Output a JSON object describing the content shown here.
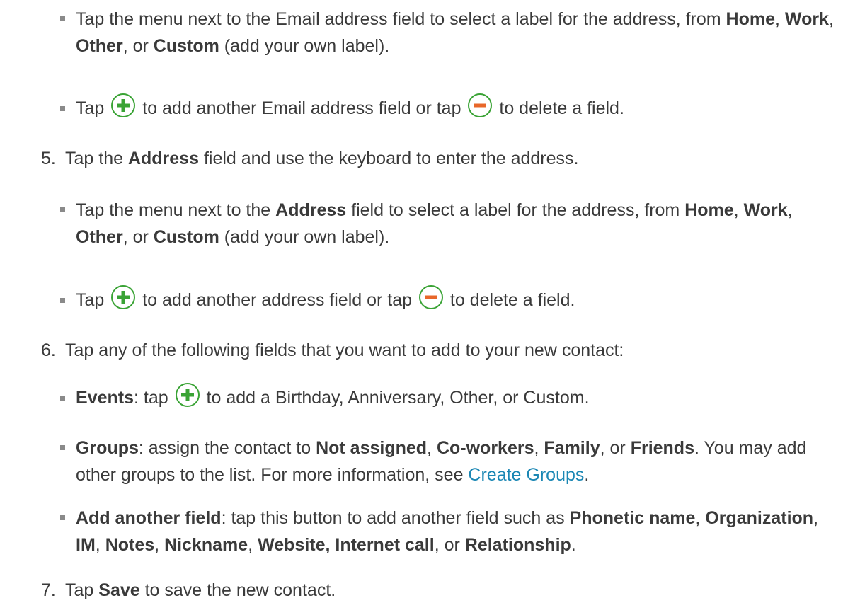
{
  "bullets_email": [
    {
      "t1": "Tap the menu next to the Email address field to select a label for the address, from ",
      "b1": "Home",
      "s1": ", ",
      "b2": "Work",
      "s2": ", ",
      "b3": "Other",
      "s3": ", or ",
      "b4": "Custom",
      "t2": " (add your own label)."
    },
    {
      "t1": "Tap ",
      "t2": " to add another Email address field or tap ",
      "t3": " to delete a field."
    }
  ],
  "step5": {
    "num": "5.",
    "t1": "Tap the ",
    "b1": "Address",
    "t2": " field and use the keyboard to enter the address.",
    "sub1": {
      "t1": "Tap the menu next to the ",
      "b1": "Address",
      "t2": " field to select a label for the address, from ",
      "b2": "Home",
      "s1": ", ",
      "b3": "Work",
      "s2": ", ",
      "b4": "Other",
      "s3": ", or ",
      "b5": "Custom",
      "t3": " (add your own label)."
    },
    "sub2": {
      "t1": "Tap ",
      "t2": " to add another address field or tap ",
      "t3": " to delete a field."
    }
  },
  "step6": {
    "num": "6.",
    "text": "Tap any of the following fields that you want to add to your new contact:",
    "events": {
      "b1": "Events",
      "t1": ": tap ",
      "t2": " to add a Birthday, Anniversary, Other, or Custom."
    },
    "groups": {
      "b1": "Groups",
      "t1": ": assign the contact to ",
      "b2": "Not assigned",
      "s1": ", ",
      "b3": "Co-workers",
      "s2": ", ",
      "b4": "Family",
      "s3": ", or ",
      "b5": "Friends",
      "t2": ". You may add other groups to the list. For more information, see ",
      "link": "Create Groups",
      "t3": "."
    },
    "another": {
      "b1": "Add another field",
      "t1": ": tap this button to add another field such as ",
      "b2": "Phonetic name",
      "s1": ", ",
      "b3": "Organization",
      "s2": ", ",
      "b4": "IM",
      "s3": ", ",
      "b5": "Notes",
      "s4": ", ",
      "b6": "Nickname",
      "s5": ", ",
      "b7": "Website, Internet call",
      "s6": ", or ",
      "b8": "Relationship",
      "t2": "."
    }
  },
  "step7": {
    "num": "7.",
    "t1": "Tap ",
    "b1": "Save",
    "t2": " to save the new contact."
  },
  "icons": {
    "add": "add-circle-icon",
    "remove": "remove-circle-icon",
    "add_color": "#3aa335",
    "remove_color": "#e8672a"
  }
}
